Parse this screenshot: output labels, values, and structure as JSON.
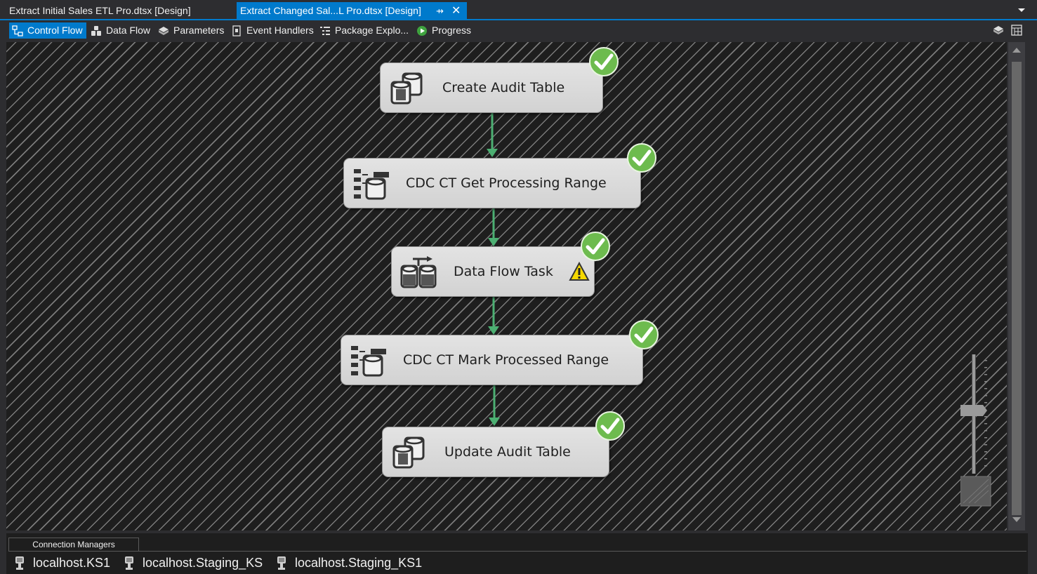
{
  "doc_tabs": [
    {
      "label": "Extract Initial Sales ETL Pro.dtsx [Design]"
    },
    {
      "label": "Extract Changed Sal...L Pro.dtsx [Design]",
      "active": true
    }
  ],
  "designer_tabs": [
    {
      "label": "Control Flow",
      "icon": "control-flow-icon",
      "active": true
    },
    {
      "label": "Data Flow",
      "icon": "data-flow-icon"
    },
    {
      "label": "Parameters",
      "icon": "parameters-icon"
    },
    {
      "label": "Event Handlers",
      "icon": "event-handlers-icon"
    },
    {
      "label": "Package Explo...",
      "icon": "package-explorer-icon"
    },
    {
      "label": "Progress",
      "icon": "progress-play-icon"
    }
  ],
  "tasks": [
    {
      "name": "Create Audit Table",
      "type": "execute-sql",
      "status": "success"
    },
    {
      "name": "CDC CT Get Processing Range",
      "type": "cdc-control",
      "status": "success"
    },
    {
      "name": "Data Flow Task",
      "type": "data-flow",
      "status": "success",
      "warning": true
    },
    {
      "name": "CDC CT Mark Processed Range",
      "type": "cdc-control",
      "status": "success"
    },
    {
      "name": "Update Audit Table",
      "type": "execute-sql",
      "status": "success"
    }
  ],
  "connection_managers": {
    "tab_label": "Connection Managers",
    "items": [
      {
        "label": "localhost.KS1"
      },
      {
        "label": "localhost.Staging_KS"
      },
      {
        "label": "localhost.Staging_KS1"
      }
    ]
  },
  "colors": {
    "accent": "#007acc",
    "success": "#5cb85c",
    "connector": "#4caf72",
    "warning": "#f5d800"
  }
}
